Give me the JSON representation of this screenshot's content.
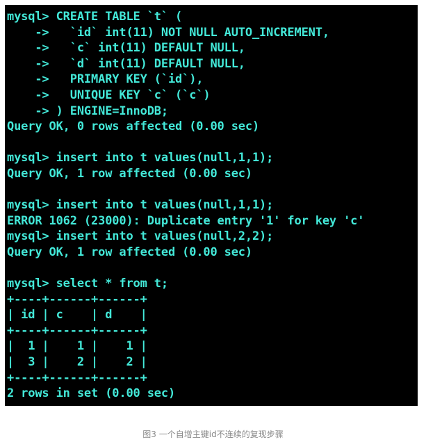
{
  "terminal": {
    "text_color": "#43e8d8",
    "background": "#000000",
    "lines": [
      "mysql> CREATE TABLE `t` (",
      "    ->   `id` int(11) NOT NULL AUTO_INCREMENT,",
      "    ->   `c` int(11) DEFAULT NULL,",
      "    ->   `d` int(11) DEFAULT NULL,",
      "    ->   PRIMARY KEY (`id`),",
      "    ->   UNIQUE KEY `c` (`c`)",
      "    -> ) ENGINE=InnoDB;",
      "Query OK, 0 rows affected (0.00 sec)",
      "",
      "mysql> insert into t values(null,1,1);",
      "Query OK, 1 row affected (0.00 sec)",
      "",
      "mysql> insert into t values(null,1,1);",
      "ERROR 1062 (23000): Duplicate entry '1' for key 'c'",
      "mysql> insert into t values(null,2,2);",
      "Query OK, 1 row affected (0.00 sec)",
      "",
      "mysql> select * from t;",
      "+----+------+------+",
      "| id | c    | d    |",
      "+----+------+------+",
      "|  1 |    1 |    1 |",
      "|  3 |    2 |    2 |",
      "+----+------+------+",
      "2 rows in set (0.00 sec)"
    ]
  },
  "caption": "图3 一个自增主键id不连续的复现步骤"
}
